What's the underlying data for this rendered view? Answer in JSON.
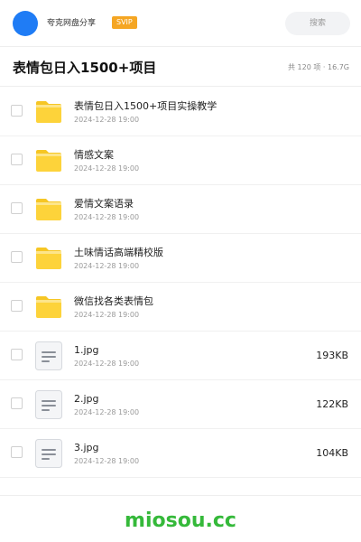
{
  "header": {
    "share_name": "夸克网盘分享",
    "svip_label": "SVIP",
    "search_placeholder": "搜索",
    "accent_color": "#1f7cf5",
    "badge_color": "#f5a623"
  },
  "folder": {
    "title": "表情包日入1500+项目",
    "meta": "共 120 项 · 16.7G"
  },
  "files": [
    {
      "type": "folder",
      "icon": "folder-icon",
      "name": "表情包日入1500+项目实操教学",
      "date": "2024-12-28 19:00",
      "size": ""
    },
    {
      "type": "folder",
      "icon": "folder-icon",
      "name": "情感文案",
      "date": "2024-12-28 19:00",
      "size": ""
    },
    {
      "type": "folder",
      "icon": "folder-icon",
      "name": "爱情文案语录",
      "date": "2024-12-28 19:00",
      "size": ""
    },
    {
      "type": "folder",
      "icon": "folder-icon",
      "name": "土味情话高端精校版",
      "date": "2024-12-28 19:00",
      "size": ""
    },
    {
      "type": "folder",
      "icon": "folder-icon",
      "name": "微信找各类表情包",
      "date": "2024-12-28 19:00",
      "size": ""
    },
    {
      "type": "file",
      "icon": "document-icon",
      "name": "1.jpg",
      "date": "2024-12-28 19:00",
      "size": "193KB"
    },
    {
      "type": "file",
      "icon": "document-icon",
      "name": "2.jpg",
      "date": "2024-12-28 19:00",
      "size": "122KB"
    },
    {
      "type": "file",
      "icon": "document-icon",
      "name": "3.jpg",
      "date": "2024-12-28 19:00",
      "size": "104KB"
    }
  ],
  "watermark": {
    "text": "miosou.cc",
    "color": "#35b93a"
  }
}
